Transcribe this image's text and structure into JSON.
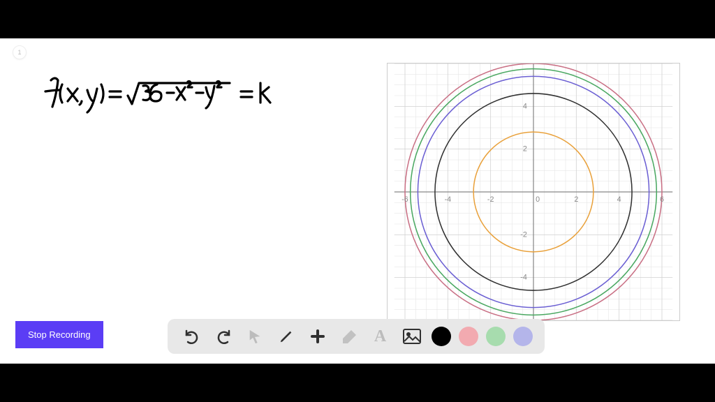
{
  "page_badge": "1",
  "handwriting": {
    "eq_lhs": "f(x,y) =",
    "eq_radical": "36 − x² − y²",
    "eq_rhs": "= k"
  },
  "stop_button_label": "Stop Recording",
  "toolbar": {
    "undo": "undo",
    "redo": "redo",
    "pointer": "pointer",
    "pencil": "pencil",
    "plus": "plus",
    "eraser": "eraser",
    "text": "A",
    "image": "image",
    "colors": {
      "black": "#000000",
      "pink": "#f2aab0",
      "green": "#a7dcae",
      "purple": "#b4b5ea"
    }
  },
  "chart_data": {
    "type": "scatter",
    "title": "",
    "xlabel": "",
    "ylabel": "",
    "xlim": [
      -6.5,
      6.5
    ],
    "ylim": [
      -6,
      6
    ],
    "tick_x": [
      -6,
      -4,
      -2,
      0,
      2,
      4,
      6
    ],
    "tick_y": [
      -4,
      -2,
      2,
      4
    ],
    "grid": true,
    "series": [
      {
        "name": "r≈2.8",
        "type": "circle",
        "cx": 0,
        "cy": 0,
        "r": 2.8,
        "color": "#e9a13b"
      },
      {
        "name": "r≈4.6",
        "type": "circle",
        "cx": 0,
        "cy": 0,
        "r": 4.6,
        "color": "#303030"
      },
      {
        "name": "r≈5.4",
        "type": "circle",
        "cx": 0,
        "cy": 0,
        "r": 5.4,
        "color": "#6b5fd3"
      },
      {
        "name": "r≈5.75",
        "type": "circle",
        "cx": 0,
        "cy": 0,
        "r": 5.75,
        "color": "#4aa861"
      },
      {
        "name": "r=6",
        "type": "circle",
        "cx": 0,
        "cy": 0,
        "r": 6.0,
        "color": "#c96f84"
      }
    ]
  }
}
